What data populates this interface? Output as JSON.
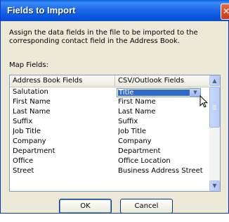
{
  "window": {
    "title": "Fields to Import"
  },
  "instruction": "Assign the data fields in the file to be imported to the corresponding contact field in the Address Book.",
  "map_label": "Map Fields:",
  "table": {
    "columns": [
      "Address Book Fields",
      "CSV/Outlook Fields"
    ],
    "rows": [
      {
        "field": "Salutation",
        "mapped": "Title"
      },
      {
        "field": "First Name",
        "mapped": "First Name"
      },
      {
        "field": "Last Name",
        "mapped": "Last Name"
      },
      {
        "field": "Suffix",
        "mapped": "Suffix"
      },
      {
        "field": "Job Title",
        "mapped": "Job Title"
      },
      {
        "field": "Company",
        "mapped": "Company"
      },
      {
        "field": "Department",
        "mapped": "Department"
      },
      {
        "field": "Office",
        "mapped": "Office Location"
      },
      {
        "field": "Street",
        "mapped": "Business Address Street"
      }
    ]
  },
  "buttons": {
    "ok": "OK",
    "cancel": "Cancel"
  },
  "colors": {
    "titlebar": "#0955e0",
    "selection": "#316ac5",
    "dialog_bg": "#ece9d8"
  },
  "icons": {
    "close": "close-icon",
    "scroll_up": "arrow-up-icon",
    "scroll_down": "arrow-down-icon",
    "dropdown": "chevron-down-icon",
    "cursor": "mouse-pointer-icon"
  }
}
